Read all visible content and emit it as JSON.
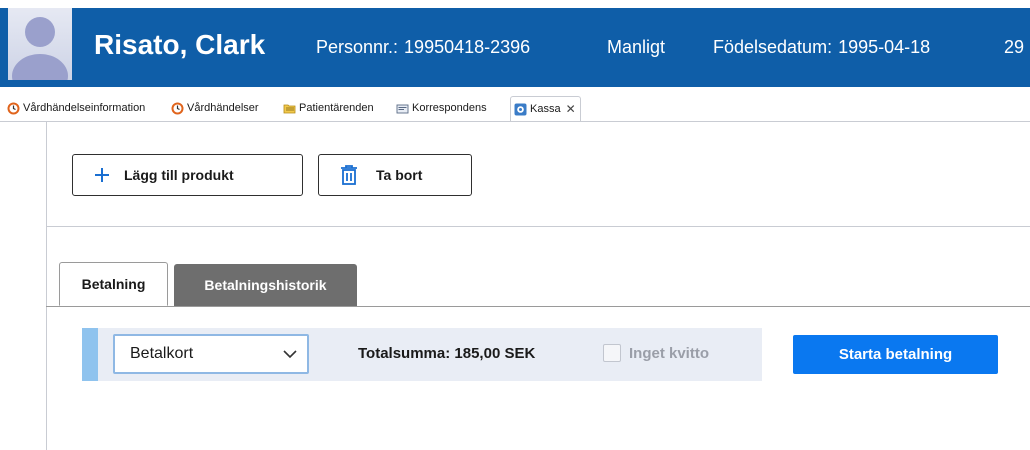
{
  "patient": {
    "name": "Risato, Clark",
    "personnr_label": "Personnr.:",
    "personnr": "19950418-2396",
    "gender": "Manligt",
    "birthdate_label": "Födelsedatum:",
    "birthdate": "1995-04-18",
    "age": "29"
  },
  "doc_tabs": [
    {
      "label": "Vårdhändelseinformation",
      "icon": "clock-icon"
    },
    {
      "label": "Vårdhändelser",
      "icon": "clock-icon"
    },
    {
      "label": "Patientärenden",
      "icon": "folder-icon"
    },
    {
      "label": "Korrespondens",
      "icon": "mail-icon"
    },
    {
      "label": "Kassa",
      "icon": "register-icon",
      "active": true
    }
  ],
  "toolbar": {
    "add_label": "Lägg till produkt",
    "delete_label": "Ta bort"
  },
  "content_tabs": [
    {
      "label": "Betalning",
      "active": true
    },
    {
      "label": "Betalningshistorik",
      "active": false
    }
  ],
  "payment": {
    "method": "Betalkort",
    "total": "Totalsumma: 185,00 SEK",
    "no_receipt_label": "Inget kvitto",
    "no_receipt_checked": false,
    "start_label": "Starta betalning"
  },
  "colors": {
    "header_bg": "#0f5ea8",
    "primary_button": "#0a78f0",
    "accent_bar": "#8fc3ee"
  }
}
